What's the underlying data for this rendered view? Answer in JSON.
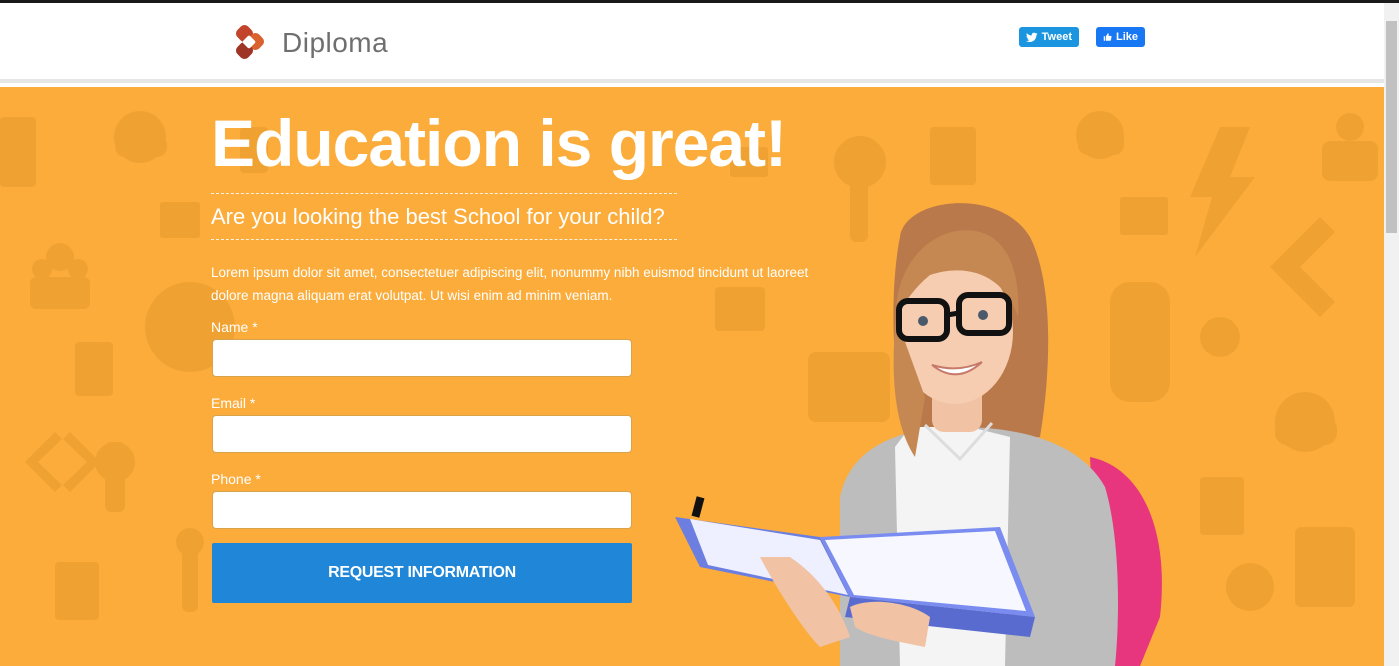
{
  "header": {
    "brand": "Diploma",
    "social": {
      "tweet_label": "Tweet",
      "like_label": "Like"
    }
  },
  "hero": {
    "headline": "Education is great!",
    "subheadline": "Are you looking the best School for your child?",
    "lead": "Lorem ipsum dolor sit amet, consectetuer adipiscing elit, nonummy nibh euismod tincidunt ut laoreet dolore magna aliquam erat volutpat. Ut wisi enim ad minim veniam."
  },
  "form": {
    "fields": [
      {
        "label": "Name *",
        "value": ""
      },
      {
        "label": "Email *",
        "value": ""
      },
      {
        "label": "Phone *",
        "value": ""
      }
    ],
    "submit_label": "REQUEST INFORMATION"
  },
  "colors": {
    "hero_background": "#fbac3b",
    "button": "#1f86d8",
    "tweet": "#1b95e0",
    "like": "#1877f2"
  },
  "icons": [
    "diploma-logo-icon",
    "twitter-bird-icon",
    "thumbs-up-icon"
  ]
}
